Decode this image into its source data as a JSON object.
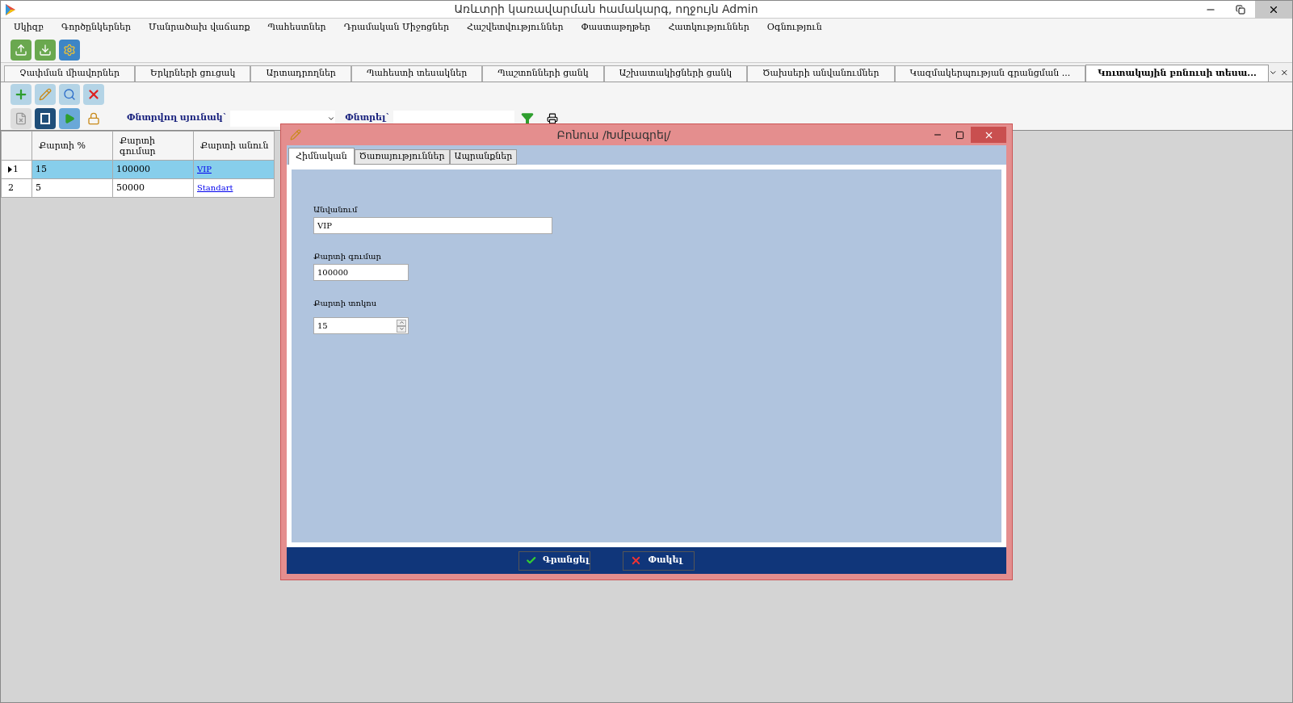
{
  "window": {
    "title": "Առևտրի կառավարման համակարգ, ողջույն Admin"
  },
  "menu": [
    "Սկիզբ",
    "Գործընկերներ",
    "Մանրածախ վաճառք",
    "Պահեստներ",
    "Դրամական Միջոցներ",
    "Հաշվետվություններ",
    "Փաստաթղթեր",
    "Հատկություններ",
    "Օգնություն"
  ],
  "tabs": [
    {
      "label": "Չափման միավորներ",
      "selected": false
    },
    {
      "label": "Երկրների ցուցակ",
      "selected": false
    },
    {
      "label": "Արտադրողներ",
      "selected": false
    },
    {
      "label": "Պահեստի տեսակներ",
      "selected": false
    },
    {
      "label": "Պաշտոնների ցանկ",
      "selected": false
    },
    {
      "label": "Աշխատակիցների ցանկ",
      "selected": false
    },
    {
      "label": "Ծախսերի անվանումներ",
      "selected": false
    },
    {
      "label": "Կազմակերպության գրանցման ...",
      "selected": false
    },
    {
      "label": "Կուտակային բոնուսի տեսա...",
      "selected": true
    }
  ],
  "search": {
    "column_label": "Փնտրվող սյունակ`",
    "search_label": "Փնտրել`"
  },
  "table": {
    "columns": [
      "Քարտի %",
      "Քարտի գումար",
      "Քարտի անուն"
    ],
    "rows": [
      {
        "index": "1",
        "selected": true,
        "cells": [
          "15",
          "100000",
          "VIP"
        ]
      },
      {
        "index": "2",
        "selected": false,
        "cells": [
          "5",
          "50000",
          "Standart"
        ]
      }
    ]
  },
  "dialog": {
    "title": "Բոնուս /Խմբագրել/",
    "tabs": [
      {
        "label": "Հիմնական",
        "selected": true
      },
      {
        "label": "Ծառայություններ",
        "selected": false
      },
      {
        "label": "Ապրանքներ",
        "selected": false
      }
    ],
    "fields": [
      {
        "kind": "text",
        "label": "Անվանում",
        "value": "VIP"
      },
      {
        "kind": "text",
        "label": "Քարտի գումար",
        "value": "100000"
      },
      {
        "kind": "spin",
        "label": "Քարտի տոկոս",
        "value": "15"
      }
    ],
    "buttons": [
      {
        "kind": "save",
        "label": "Գրանցել"
      },
      {
        "kind": "close",
        "label": "Փակել"
      }
    ]
  }
}
